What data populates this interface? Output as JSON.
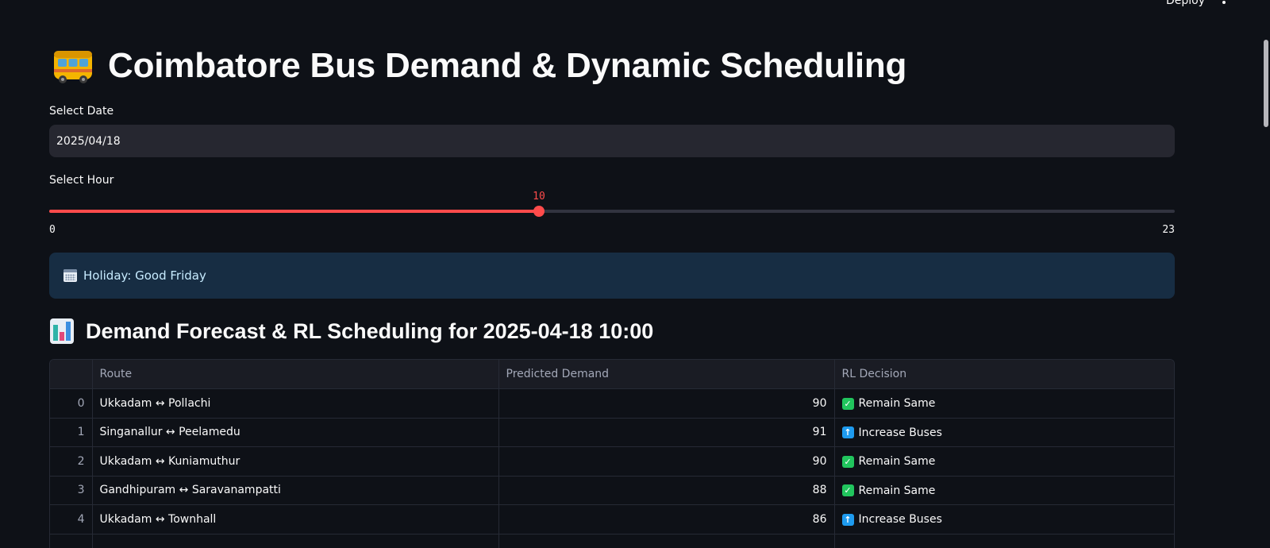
{
  "header": {
    "deploy_label": "Deploy"
  },
  "title": "Coimbatore Bus Demand & Dynamic Scheduling",
  "date_picker": {
    "label": "Select Date",
    "value": "2025/04/18"
  },
  "hour_slider": {
    "label": "Select Hour",
    "value": "10",
    "min": "0",
    "max": "23"
  },
  "holiday_info": {
    "text": "Holiday: Good Friday"
  },
  "section": {
    "title": "Demand Forecast & RL Scheduling for 2025-04-18 10:00"
  },
  "table": {
    "columns": [
      "",
      "Route",
      "Predicted Demand",
      "RL Decision"
    ],
    "rows": [
      {
        "index": "0",
        "route": "Ukkadam ↔ Pollachi",
        "demand": "90",
        "decision": "Remain Same",
        "icon": "check-icon"
      },
      {
        "index": "1",
        "route": "Singanallur ↔ Peelamedu",
        "demand": "91",
        "decision": "Increase Buses",
        "icon": "up-arrow-icon"
      },
      {
        "index": "2",
        "route": "Ukkadam ↔ Kuniamuthur",
        "demand": "90",
        "decision": "Remain Same",
        "icon": "check-icon"
      },
      {
        "index": "3",
        "route": "Gandhipuram ↔ Saravanampatti",
        "demand": "88",
        "decision": "Remain Same",
        "icon": "check-icon"
      },
      {
        "index": "4",
        "route": "Ukkadam ↔ Townhall",
        "demand": "86",
        "decision": "Increase Buses",
        "icon": "up-arrow-icon"
      }
    ]
  },
  "colors": {
    "background": "#0e1117",
    "accent": "#ff4b4b",
    "info_bg": "#172d43",
    "input_bg": "#262730"
  }
}
